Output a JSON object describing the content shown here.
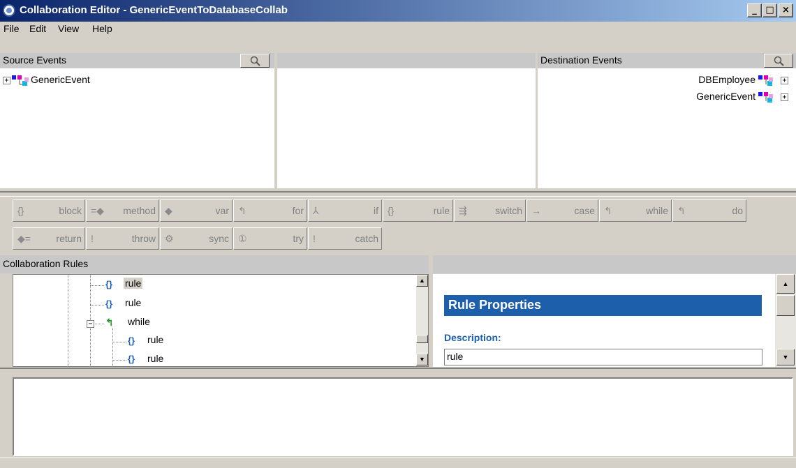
{
  "window": {
    "title": "Collaboration Editor - GenericEventToDatabaseCollab",
    "controls": [
      "_",
      "□",
      "×"
    ]
  },
  "menu": [
    "File",
    "Edit",
    "View",
    "Help"
  ],
  "source_events": {
    "header": "Source Events",
    "items": [
      {
        "label": "GenericEvent"
      }
    ]
  },
  "destination_events": {
    "header": "Destination Events",
    "items": [
      {
        "label": "DBEmployee"
      },
      {
        "label": "GenericEvent"
      }
    ]
  },
  "toolbar": {
    "row1": [
      {
        "icon": "{}",
        "label": "block"
      },
      {
        "icon": "=◆",
        "label": "method"
      },
      {
        "icon": "◆",
        "label": "var"
      },
      {
        "icon": "↰",
        "label": "for"
      },
      {
        "icon": "⅄",
        "label": "if"
      },
      {
        "icon": "{}",
        "label": "rule"
      },
      {
        "icon": "⇶",
        "label": "switch"
      },
      {
        "icon": "→",
        "label": "case"
      },
      {
        "icon": "↰",
        "label": "while"
      },
      {
        "icon": "↰",
        "label": "do"
      }
    ],
    "row2": [
      {
        "icon": "◆=",
        "label": "return"
      },
      {
        "icon": "!",
        "label": "throw"
      },
      {
        "icon": "⚙",
        "label": "sync"
      },
      {
        "icon": "①",
        "label": "try"
      },
      {
        "icon": "!",
        "label": "catch"
      }
    ]
  },
  "collab_rules": {
    "header": "Collaboration Rules",
    "tree": [
      {
        "icon": "{}",
        "label": "rule",
        "selected": true
      },
      {
        "icon": "{}",
        "label": "rule"
      },
      {
        "icon": "↰",
        "label": "while"
      },
      {
        "icon": "{}",
        "label": "rule"
      },
      {
        "icon": "{}",
        "label": "rule"
      }
    ]
  },
  "rule_properties": {
    "title": "Rule Properties",
    "description_label": "Description:",
    "description_value": "rule"
  },
  "colors": {
    "title_start": "#0a246a",
    "title_end": "#a6caf0",
    "props_header": "#1e5fac",
    "rule_icon": "#1e5fac",
    "while_icon": "#2a9a2a"
  }
}
